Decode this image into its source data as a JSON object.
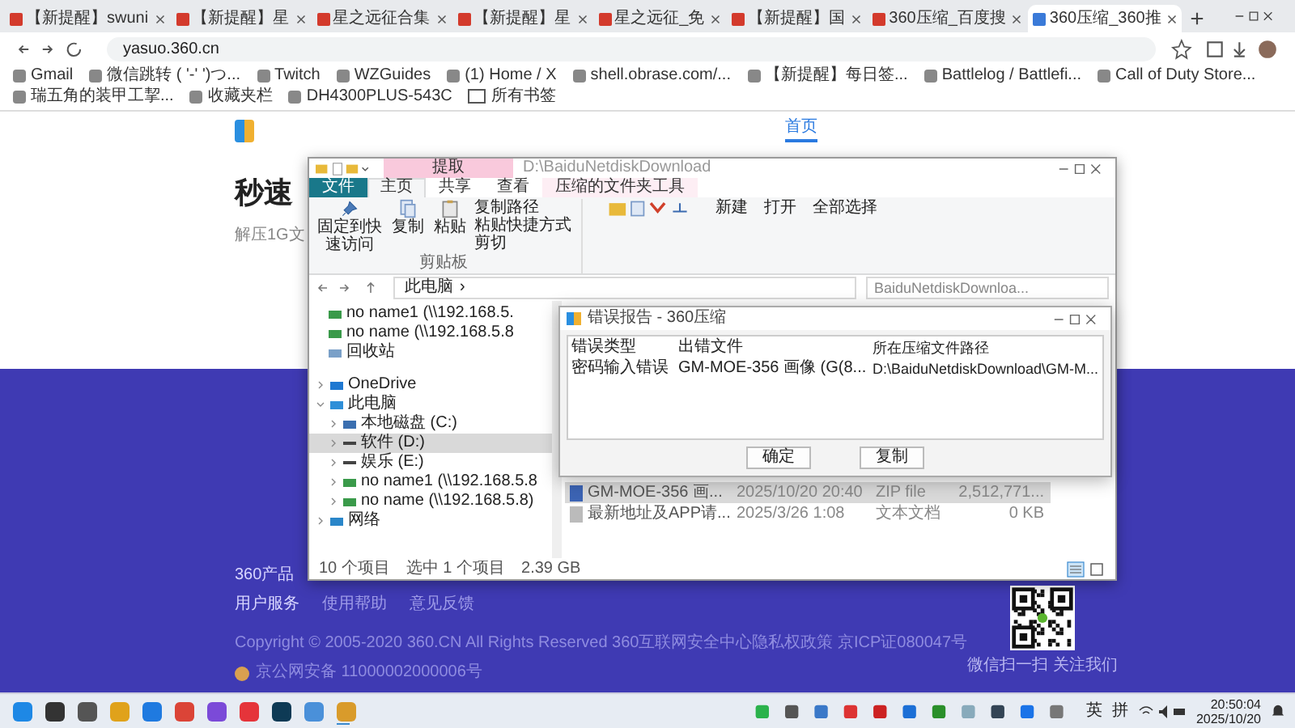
{
  "browser": {
    "tabs": [
      {
        "title": "【新提醒】swuni",
        "selected": false
      },
      {
        "title": "【新提醒】星",
        "selected": false
      },
      {
        "title": "星之远征合集",
        "selected": false
      },
      {
        "title": "【新提醒】星",
        "selected": false
      },
      {
        "title": "星之远征_免",
        "selected": false
      },
      {
        "title": "【新提醒】国",
        "selected": false
      },
      {
        "title": "360压缩_百度搜",
        "selected": false
      },
      {
        "title": "360压缩_360推",
        "selected": true
      }
    ],
    "url": "yasuo.360.cn",
    "bookmarks": [
      "Gmail",
      "微信跳转 ( '-' ')つ...",
      "Twitch",
      "WZGuides",
      "(1) Home / X",
      "shell.obrase.com/...",
      "【新提醒】每日签...",
      "Battlelog / Battlefi...",
      "Call of Duty Store...",
      "瑞五角的装甲工挈...",
      "收藏夹栏",
      "DH4300PLUS-543C"
    ],
    "all_bookmarks": "所有书签"
  },
  "page": {
    "nav": [
      "首页"
    ],
    "heading": "秒速",
    "subheading": "解压1G文",
    "footer": {
      "products": "360产品",
      "services": "用户服务",
      "links": [
        "使用帮助",
        "意见反馈"
      ],
      "copyright": "Copyright © 2005-2020 360.CN All Rights Reserved 360互联网安全中心隐私权政策 京ICP证080047号",
      "police": "京公网安备 11000002000006号",
      "qr_caption": "微信扫一扫 关注我们"
    }
  },
  "explorer": {
    "context_tab": "提取",
    "path_title": "D:\\BaiduNetdiskDownload",
    "ribbon_tabs": [
      {
        "label": "文件",
        "kind": "file",
        "selected": false
      },
      {
        "label": "主页",
        "kind": "tab",
        "selected": true
      },
      {
        "label": "共享",
        "kind": "tab",
        "selected": false
      },
      {
        "label": "查看",
        "kind": "tab",
        "selected": false
      },
      {
        "label": "压缩的文件夹工具",
        "kind": "tool",
        "selected": false
      }
    ],
    "clipboard": {
      "pin": "固定到快速访问",
      "copy": "复制",
      "paste": "粘贴",
      "copy_path": "复制路径",
      "paste_shortcut": "粘贴快捷方式",
      "cut": "剪切",
      "group": "剪贴板"
    },
    "new": "新建",
    "open": "打开",
    "select_all": "全部选择",
    "crumb": "此电脑",
    "crumb_separator": "›",
    "search_placeholder": "BaiduNetdiskDownloa...",
    "quick_access": [
      {
        "label": "no name1 (\\\\192.168.5.",
        "kind": "netdrive"
      },
      {
        "label": "no name (\\\\192.168.5.8",
        "kind": "netdrive"
      },
      {
        "label": "回收站",
        "kind": "recycle"
      }
    ],
    "tree": [
      {
        "label": "OneDrive",
        "kind": "cloud",
        "expanded": false,
        "selected": false
      },
      {
        "label": "此电脑",
        "kind": "pc",
        "expanded": true,
        "selected": false,
        "children": [
          {
            "label": "本地磁盘 (C:)",
            "kind": "system",
            "expanded": false,
            "selected": false
          },
          {
            "label": "软件 (D:)",
            "kind": "drive",
            "expanded": false,
            "selected": true
          },
          {
            "label": "娱乐 (E:)",
            "kind": "drive",
            "expanded": false,
            "selected": false
          },
          {
            "label": "no name1 (\\\\192.168.5.8",
            "kind": "netdrive",
            "expanded": false,
            "selected": false
          },
          {
            "label": "no name (\\\\192.168.5.8)",
            "kind": "netdrive",
            "expanded": false,
            "selected": false
          }
        ]
      },
      {
        "label": "网络",
        "kind": "network",
        "expanded": false,
        "selected": false
      }
    ],
    "files": [
      {
        "name": "GM-MOE-356 画...",
        "date": "2025/10/20 20:40",
        "type": "ZIP file",
        "size": "2,512,771...",
        "kind": "zip",
        "selected": true
      },
      {
        "name": "最新地址及APP请...",
        "date": "2025/3/26 1:08",
        "type": "文本文档",
        "size": "0 KB",
        "kind": "text",
        "selected": false
      }
    ],
    "status": {
      "count": "10 个项目",
      "selection": "选中 1 个项目",
      "size": "2.39 GB"
    }
  },
  "dialog": {
    "title": "错误报告 - 360压缩",
    "columns": [
      "错误类型",
      "出错文件",
      "所在压缩文件路径"
    ],
    "rows": [
      [
        "密码输入错误",
        "GM-MOE-356 画像 (G(8...",
        "D:\\BaiduNetdiskDownload\\GM-M..."
      ]
    ],
    "buttons": [
      "确定",
      "复制"
    ]
  },
  "taskbar": {
    "ime": [
      "英",
      "拼"
    ],
    "time": "20:50:04",
    "date": "2025/10/20"
  }
}
